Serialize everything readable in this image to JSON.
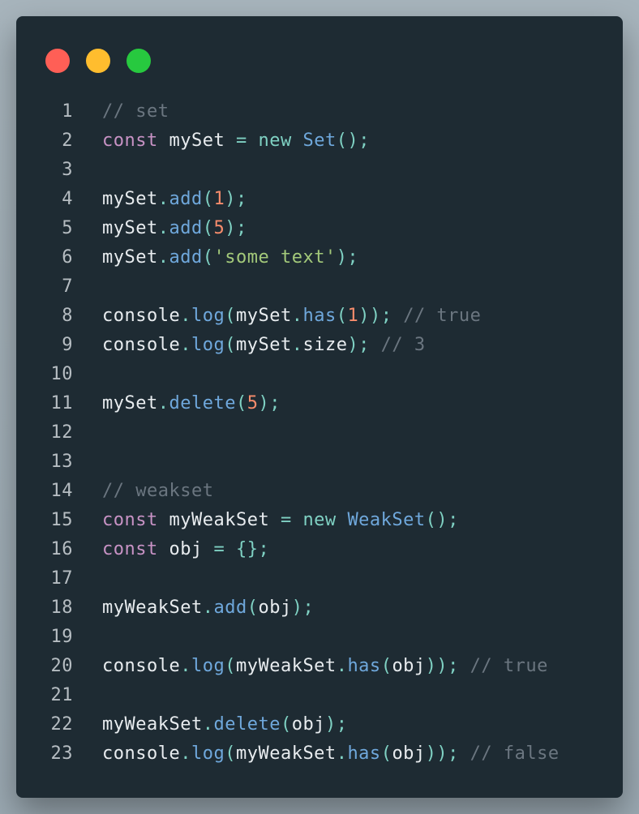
{
  "window": {
    "traffic_lights": [
      {
        "name": "close",
        "color": "#ff5f56"
      },
      {
        "name": "minimize",
        "color": "#ffbd2e"
      },
      {
        "name": "maximize",
        "color": "#27c93f"
      }
    ]
  },
  "colors": {
    "background": "#1e2b33",
    "comment": "#6b7680",
    "keyword": "#c792c4",
    "operator": "#7fd1c3",
    "function": "#6fa8dc",
    "number": "#f78c6c",
    "string": "#a3c97a",
    "text": "#e8ecef",
    "line_number": "#b6bdc2"
  },
  "code": {
    "lines": [
      {
        "num": "1",
        "tokens": [
          {
            "t": "// set",
            "k": "comment"
          }
        ]
      },
      {
        "num": "2",
        "tokens": [
          {
            "t": "const",
            "k": "keyword"
          },
          {
            "t": " mySet ",
            "k": "ident"
          },
          {
            "t": "=",
            "k": "operator"
          },
          {
            "t": " ",
            "k": "ident"
          },
          {
            "t": "new",
            "k": "operator"
          },
          {
            "t": " ",
            "k": "ident"
          },
          {
            "t": "Set",
            "k": "class"
          },
          {
            "t": "();",
            "k": "punct"
          }
        ]
      },
      {
        "num": "3",
        "tokens": []
      },
      {
        "num": "4",
        "tokens": [
          {
            "t": "mySet",
            "k": "ident"
          },
          {
            "t": ".",
            "k": "punct"
          },
          {
            "t": "add",
            "k": "func"
          },
          {
            "t": "(",
            "k": "punct"
          },
          {
            "t": "1",
            "k": "number"
          },
          {
            "t": ");",
            "k": "punct"
          }
        ]
      },
      {
        "num": "5",
        "tokens": [
          {
            "t": "mySet",
            "k": "ident"
          },
          {
            "t": ".",
            "k": "punct"
          },
          {
            "t": "add",
            "k": "func"
          },
          {
            "t": "(",
            "k": "punct"
          },
          {
            "t": "5",
            "k": "number"
          },
          {
            "t": ");",
            "k": "punct"
          }
        ]
      },
      {
        "num": "6",
        "tokens": [
          {
            "t": "mySet",
            "k": "ident"
          },
          {
            "t": ".",
            "k": "punct"
          },
          {
            "t": "add",
            "k": "func"
          },
          {
            "t": "(",
            "k": "punct"
          },
          {
            "t": "'some text'",
            "k": "string"
          },
          {
            "t": ");",
            "k": "punct"
          }
        ]
      },
      {
        "num": "7",
        "tokens": []
      },
      {
        "num": "8",
        "tokens": [
          {
            "t": "console",
            "k": "ident"
          },
          {
            "t": ".",
            "k": "punct"
          },
          {
            "t": "log",
            "k": "func"
          },
          {
            "t": "(",
            "k": "punct"
          },
          {
            "t": "mySet",
            "k": "ident"
          },
          {
            "t": ".",
            "k": "punct"
          },
          {
            "t": "has",
            "k": "func"
          },
          {
            "t": "(",
            "k": "punct"
          },
          {
            "t": "1",
            "k": "number"
          },
          {
            "t": "));",
            "k": "punct"
          },
          {
            "t": " // true",
            "k": "comment"
          }
        ]
      },
      {
        "num": "9",
        "tokens": [
          {
            "t": "console",
            "k": "ident"
          },
          {
            "t": ".",
            "k": "punct"
          },
          {
            "t": "log",
            "k": "func"
          },
          {
            "t": "(",
            "k": "punct"
          },
          {
            "t": "mySet",
            "k": "ident"
          },
          {
            "t": ".",
            "k": "punct"
          },
          {
            "t": "size",
            "k": "ident"
          },
          {
            "t": ");",
            "k": "punct"
          },
          {
            "t": " // 3",
            "k": "comment"
          }
        ]
      },
      {
        "num": "10",
        "tokens": []
      },
      {
        "num": "11",
        "tokens": [
          {
            "t": "mySet",
            "k": "ident"
          },
          {
            "t": ".",
            "k": "punct"
          },
          {
            "t": "delete",
            "k": "func"
          },
          {
            "t": "(",
            "k": "punct"
          },
          {
            "t": "5",
            "k": "number"
          },
          {
            "t": ");",
            "k": "punct"
          }
        ]
      },
      {
        "num": "12",
        "tokens": []
      },
      {
        "num": "13",
        "tokens": []
      },
      {
        "num": "14",
        "tokens": [
          {
            "t": "// weakset",
            "k": "comment"
          }
        ]
      },
      {
        "num": "15",
        "tokens": [
          {
            "t": "const",
            "k": "keyword"
          },
          {
            "t": " myWeakSet ",
            "k": "ident"
          },
          {
            "t": "=",
            "k": "operator"
          },
          {
            "t": " ",
            "k": "ident"
          },
          {
            "t": "new",
            "k": "operator"
          },
          {
            "t": " ",
            "k": "ident"
          },
          {
            "t": "WeakSet",
            "k": "class"
          },
          {
            "t": "();",
            "k": "punct"
          }
        ]
      },
      {
        "num": "16",
        "tokens": [
          {
            "t": "const",
            "k": "keyword"
          },
          {
            "t": " obj ",
            "k": "ident"
          },
          {
            "t": "=",
            "k": "operator"
          },
          {
            "t": " ",
            "k": "ident"
          },
          {
            "t": "{};",
            "k": "punct"
          }
        ]
      },
      {
        "num": "17",
        "tokens": []
      },
      {
        "num": "18",
        "tokens": [
          {
            "t": "myWeakSet",
            "k": "ident"
          },
          {
            "t": ".",
            "k": "punct"
          },
          {
            "t": "add",
            "k": "func"
          },
          {
            "t": "(",
            "k": "punct"
          },
          {
            "t": "obj",
            "k": "ident"
          },
          {
            "t": ");",
            "k": "punct"
          }
        ]
      },
      {
        "num": "19",
        "tokens": []
      },
      {
        "num": "20",
        "tokens": [
          {
            "t": "console",
            "k": "ident"
          },
          {
            "t": ".",
            "k": "punct"
          },
          {
            "t": "log",
            "k": "func"
          },
          {
            "t": "(",
            "k": "punct"
          },
          {
            "t": "myWeakSet",
            "k": "ident"
          },
          {
            "t": ".",
            "k": "punct"
          },
          {
            "t": "has",
            "k": "func"
          },
          {
            "t": "(",
            "k": "punct"
          },
          {
            "t": "obj",
            "k": "ident"
          },
          {
            "t": "));",
            "k": "punct"
          },
          {
            "t": " // true",
            "k": "comment"
          }
        ]
      },
      {
        "num": "21",
        "tokens": []
      },
      {
        "num": "22",
        "tokens": [
          {
            "t": "myWeakSet",
            "k": "ident"
          },
          {
            "t": ".",
            "k": "punct"
          },
          {
            "t": "delete",
            "k": "func"
          },
          {
            "t": "(",
            "k": "punct"
          },
          {
            "t": "obj",
            "k": "ident"
          },
          {
            "t": ");",
            "k": "punct"
          }
        ]
      },
      {
        "num": "23",
        "tokens": [
          {
            "t": "console",
            "k": "ident"
          },
          {
            "t": ".",
            "k": "punct"
          },
          {
            "t": "log",
            "k": "func"
          },
          {
            "t": "(",
            "k": "punct"
          },
          {
            "t": "myWeakSet",
            "k": "ident"
          },
          {
            "t": ".",
            "k": "punct"
          },
          {
            "t": "has",
            "k": "func"
          },
          {
            "t": "(",
            "k": "punct"
          },
          {
            "t": "obj",
            "k": "ident"
          },
          {
            "t": "));",
            "k": "punct"
          },
          {
            "t": " // false",
            "k": "comment"
          }
        ]
      }
    ]
  }
}
